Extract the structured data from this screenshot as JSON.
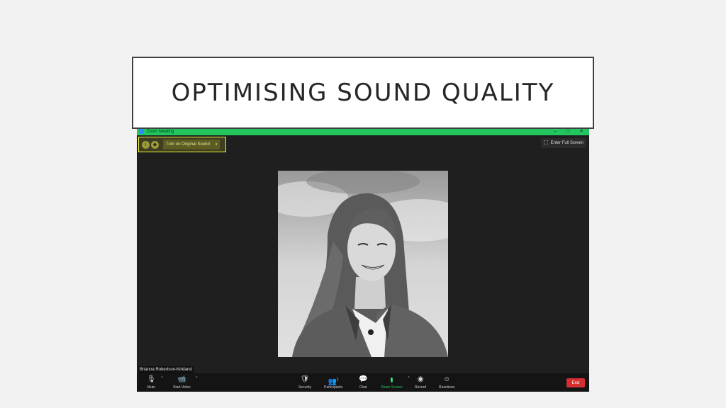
{
  "slide": {
    "title": "OPTIMISING SOUND QUALITY"
  },
  "window": {
    "title": "Zoom Meeting",
    "controls": {
      "minimize": "–",
      "maximize": "□",
      "close": "✕"
    }
  },
  "sound_bar": {
    "label": "Turn on Original Sound",
    "caret": "▾",
    "highlight_color": "#f2ef3a"
  },
  "fullscreen": {
    "label": "Enter Full Screen",
    "icon": "fullscreen-icon"
  },
  "participant": {
    "name": "Brianna Robertson-Kirkland"
  },
  "toolbar": {
    "mute": "Mute",
    "start_video": "Start Video",
    "security": "Security",
    "participants": "Participants",
    "participants_count": "1",
    "chat": "Chat",
    "share_screen": "Share Screen",
    "record": "Record",
    "reactions": "Reactions",
    "end": "End",
    "caret": "^"
  },
  "colors": {
    "titlebar": "#22c55e",
    "end": "#d32f2f",
    "share": "#22c55e"
  }
}
